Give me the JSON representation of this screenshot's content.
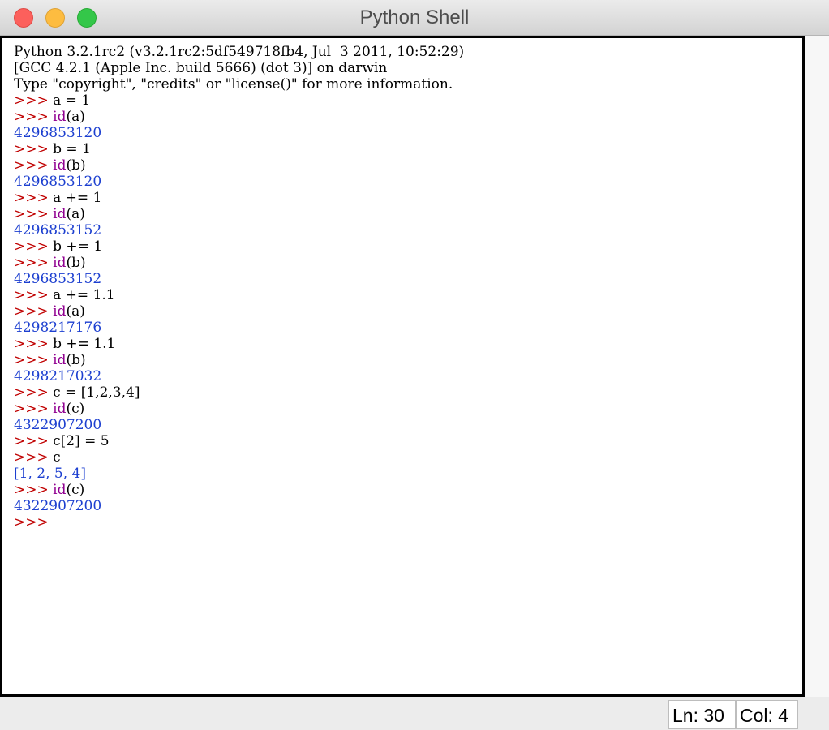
{
  "window": {
    "title": "Python Shell"
  },
  "shell": {
    "lines": [
      [
        {
          "t": "Python 3.2.1rc2 (v3.2.1rc2:5df549718fb4, Jul  3 2011, 10:52:29)",
          "c": "plain"
        }
      ],
      [
        {
          "t": "[GCC 4.2.1 (Apple Inc. build 5666) (dot 3)] on darwin",
          "c": "plain"
        }
      ],
      [
        {
          "t": "Type \"copyright\", \"credits\" or \"license()\" for more information.",
          "c": "plain"
        }
      ],
      [
        {
          "t": ">>> ",
          "c": "prompt"
        },
        {
          "t": "a = 1",
          "c": "plain"
        }
      ],
      [
        {
          "t": ">>> ",
          "c": "prompt"
        },
        {
          "t": "id",
          "c": "builtin"
        },
        {
          "t": "(a)",
          "c": "plain"
        }
      ],
      [
        {
          "t": "4296853120",
          "c": "output"
        }
      ],
      [
        {
          "t": ">>> ",
          "c": "prompt"
        },
        {
          "t": "b = 1",
          "c": "plain"
        }
      ],
      [
        {
          "t": ">>> ",
          "c": "prompt"
        },
        {
          "t": "id",
          "c": "builtin"
        },
        {
          "t": "(b)",
          "c": "plain"
        }
      ],
      [
        {
          "t": "4296853120",
          "c": "output"
        }
      ],
      [
        {
          "t": ">>> ",
          "c": "prompt"
        },
        {
          "t": "a += 1",
          "c": "plain"
        }
      ],
      [
        {
          "t": ">>> ",
          "c": "prompt"
        },
        {
          "t": "id",
          "c": "builtin"
        },
        {
          "t": "(a)",
          "c": "plain"
        }
      ],
      [
        {
          "t": "4296853152",
          "c": "output"
        }
      ],
      [
        {
          "t": ">>> ",
          "c": "prompt"
        },
        {
          "t": "b += 1",
          "c": "plain"
        }
      ],
      [
        {
          "t": ">>> ",
          "c": "prompt"
        },
        {
          "t": "id",
          "c": "builtin"
        },
        {
          "t": "(b)",
          "c": "plain"
        }
      ],
      [
        {
          "t": "4296853152",
          "c": "output"
        }
      ],
      [
        {
          "t": ">>> ",
          "c": "prompt"
        },
        {
          "t": "a += 1.1",
          "c": "plain"
        }
      ],
      [
        {
          "t": ">>> ",
          "c": "prompt"
        },
        {
          "t": "id",
          "c": "builtin"
        },
        {
          "t": "(a)",
          "c": "plain"
        }
      ],
      [
        {
          "t": "4298217176",
          "c": "output"
        }
      ],
      [
        {
          "t": ">>> ",
          "c": "prompt"
        },
        {
          "t": "b += 1.1",
          "c": "plain"
        }
      ],
      [
        {
          "t": ">>> ",
          "c": "prompt"
        },
        {
          "t": "id",
          "c": "builtin"
        },
        {
          "t": "(b)",
          "c": "plain"
        }
      ],
      [
        {
          "t": "4298217032",
          "c": "output"
        }
      ],
      [
        {
          "t": ">>> ",
          "c": "prompt"
        },
        {
          "t": "c = [1,2,3,4]",
          "c": "plain"
        }
      ],
      [
        {
          "t": ">>> ",
          "c": "prompt"
        },
        {
          "t": "id",
          "c": "builtin"
        },
        {
          "t": "(c)",
          "c": "plain"
        }
      ],
      [
        {
          "t": "4322907200",
          "c": "output"
        }
      ],
      [
        {
          "t": ">>> ",
          "c": "prompt"
        },
        {
          "t": "c[2] = 5",
          "c": "plain"
        }
      ],
      [
        {
          "t": ">>> ",
          "c": "prompt"
        },
        {
          "t": "c",
          "c": "plain"
        }
      ],
      [
        {
          "t": "[1, 2, 5, 4]",
          "c": "output"
        }
      ],
      [
        {
          "t": ">>> ",
          "c": "prompt"
        },
        {
          "t": "id",
          "c": "builtin"
        },
        {
          "t": "(c)",
          "c": "plain"
        }
      ],
      [
        {
          "t": "4322907200",
          "c": "output"
        }
      ],
      [
        {
          "t": ">>> ",
          "c": "prompt"
        }
      ]
    ]
  },
  "status": {
    "line": "Ln: 30",
    "column": "Col: 4"
  },
  "colors": {
    "prompt": "#c00000",
    "builtin": "#900090",
    "output": "#1c3fd0",
    "text": "#000000"
  },
  "icons": {
    "close": "close-light",
    "minimize": "minimize-light",
    "zoom": "zoom-light"
  }
}
